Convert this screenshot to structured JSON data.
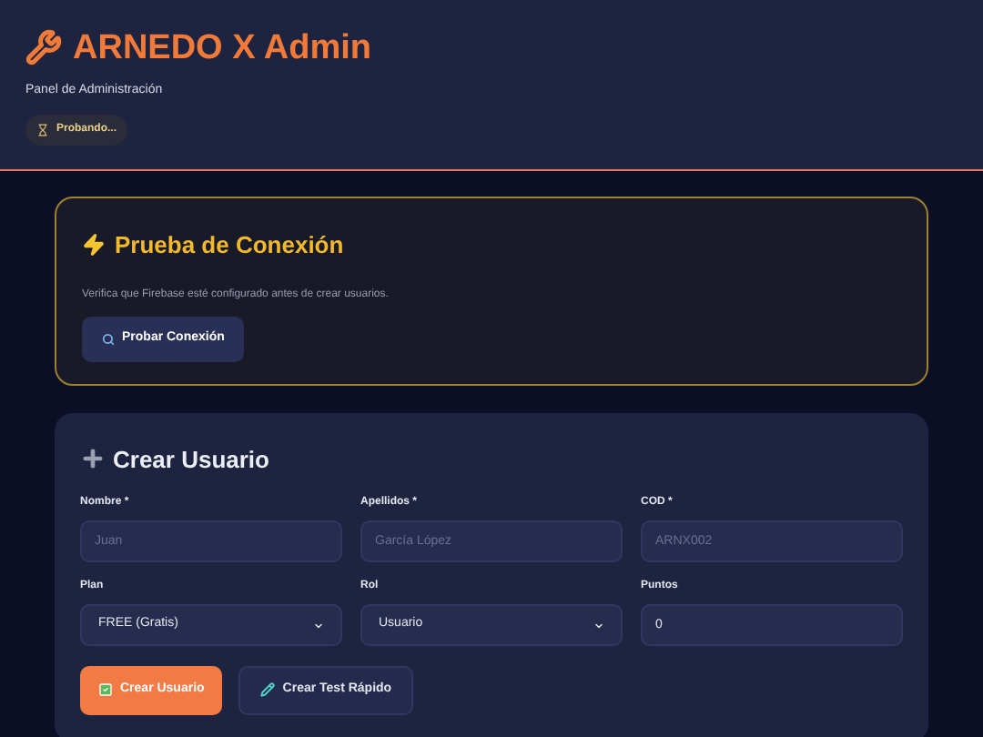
{
  "header": {
    "title": "ARNEDO X Admin",
    "subtitle": "Panel de Administración",
    "status_badge": "Probando..."
  },
  "connection_card": {
    "title": "Prueba de Conexión",
    "description": "Verifica que Firebase esté configurado antes de crear usuarios.",
    "button": "Probar Conexión"
  },
  "create_user_card": {
    "title": "Crear Usuario",
    "fields": [
      {
        "label": "Nombre *",
        "kind": "input",
        "placeholder": "Juan"
      },
      {
        "label": "Apellidos *",
        "kind": "input",
        "placeholder": "García López"
      },
      {
        "label": "COD *",
        "kind": "input",
        "placeholder": "ARNX002"
      },
      {
        "label": "Plan",
        "kind": "select",
        "value": "FREE (Gratis)"
      },
      {
        "label": "Rol",
        "kind": "select",
        "value": "Usuario"
      },
      {
        "label": "Puntos",
        "kind": "input",
        "value": "0"
      }
    ],
    "buttons": [
      {
        "label": "Crear Usuario",
        "kind": "primary"
      },
      {
        "label": "Crear Test Rápido",
        "kind": "secondary"
      }
    ]
  }
}
